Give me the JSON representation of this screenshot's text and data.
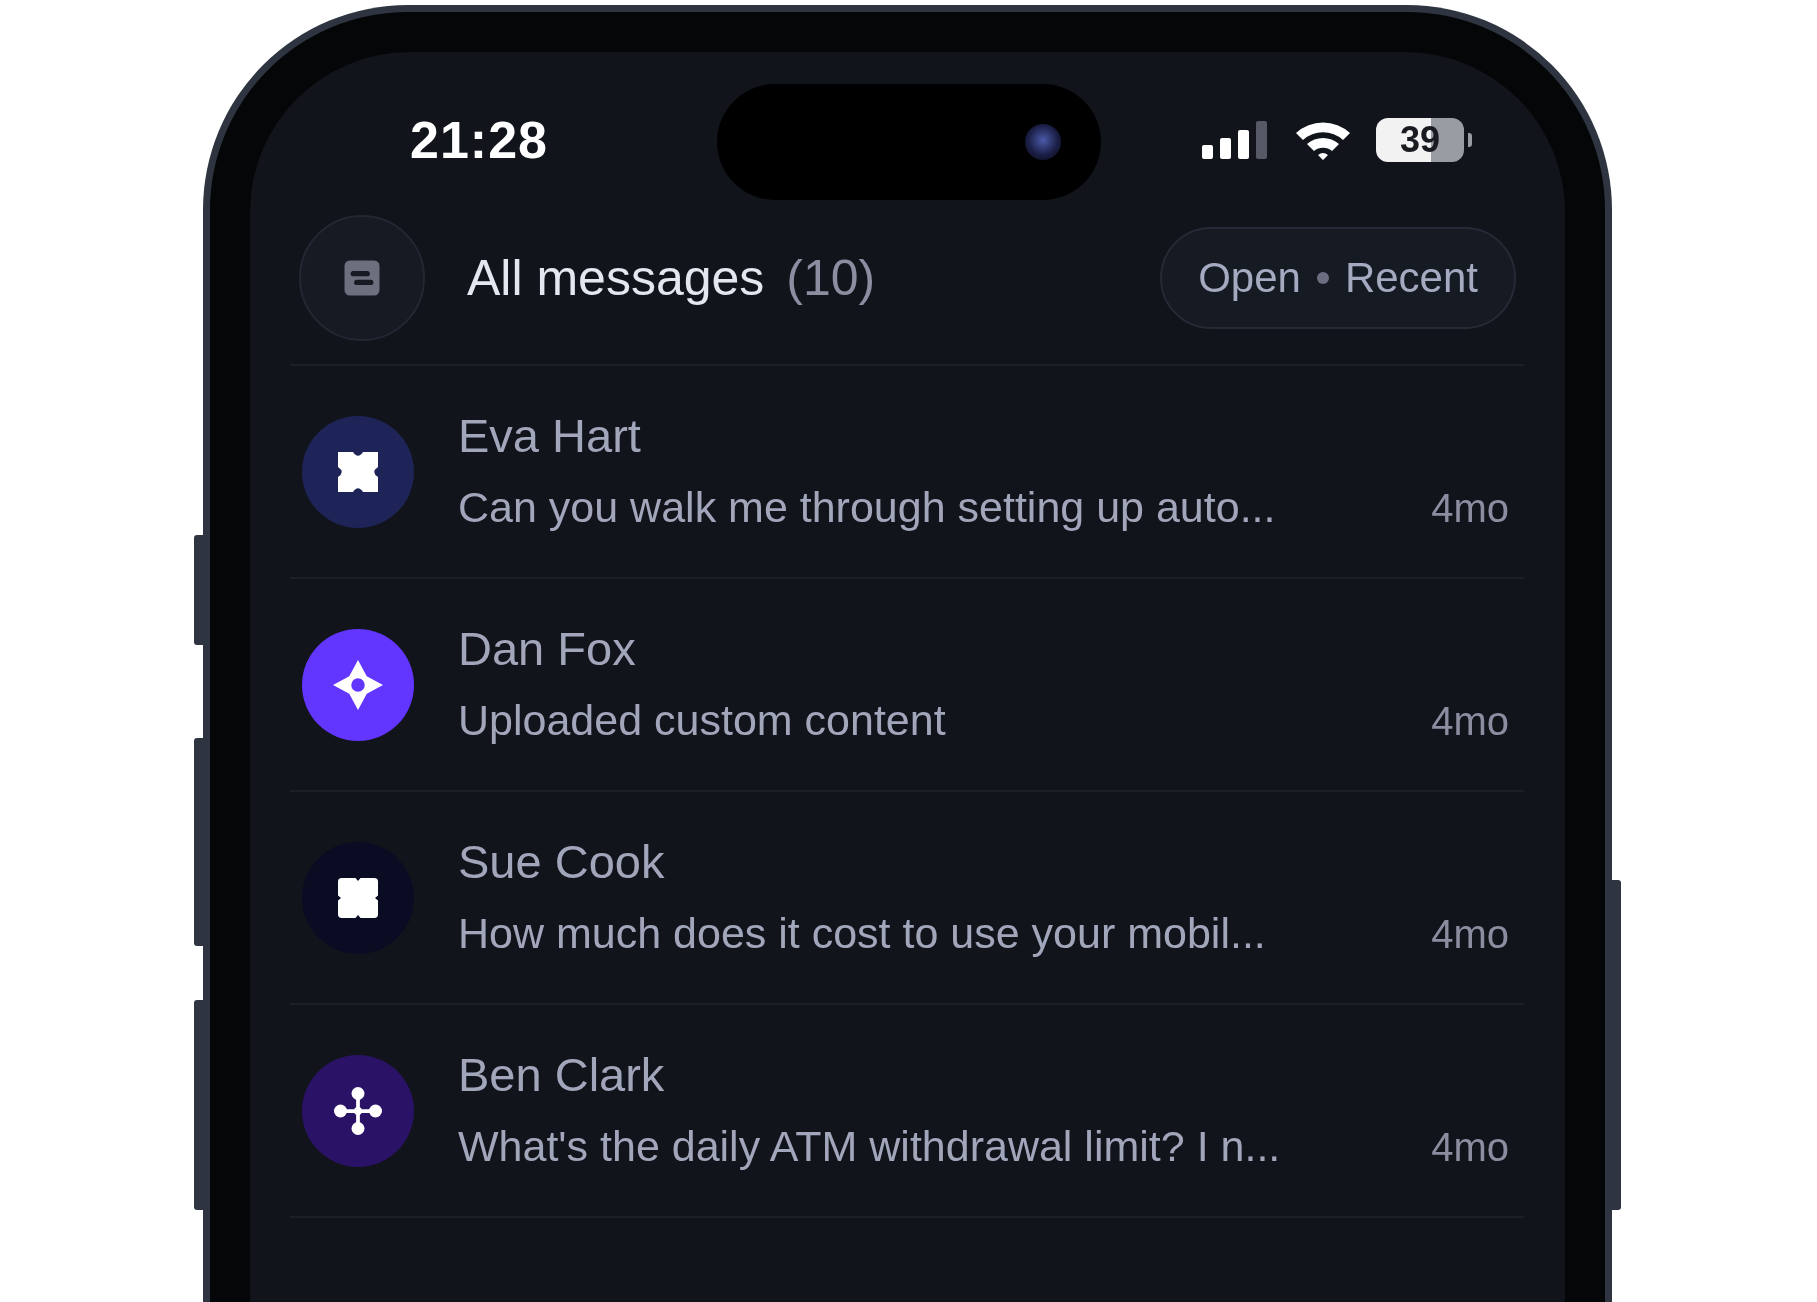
{
  "status_bar": {
    "time": "21:28",
    "battery": "39"
  },
  "header": {
    "title": "All messages",
    "count": "(10)",
    "filter": {
      "status": "Open",
      "sort": "Recent"
    }
  },
  "conversations": [
    {
      "name": "Eva Hart",
      "preview": "Can you walk me through setting up auto...",
      "age": "4mo",
      "avatar": {
        "kind": "petals",
        "color": "#1e2457"
      }
    },
    {
      "name": "Dan Fox",
      "preview": "Uploaded custom content",
      "age": "4mo",
      "avatar": {
        "kind": "diamond",
        "color": "#6236ff"
      }
    },
    {
      "name": "Sue Cook",
      "preview": "How much does it cost to use your mobil...",
      "age": "4mo",
      "avatar": {
        "kind": "squares",
        "color": "#0a0c24"
      }
    },
    {
      "name": "Ben Clark",
      "preview": "What's the daily ATM withdrawal limit? I n...",
      "age": "4mo",
      "avatar": {
        "kind": "nodes",
        "color": "#2a1266"
      }
    }
  ]
}
